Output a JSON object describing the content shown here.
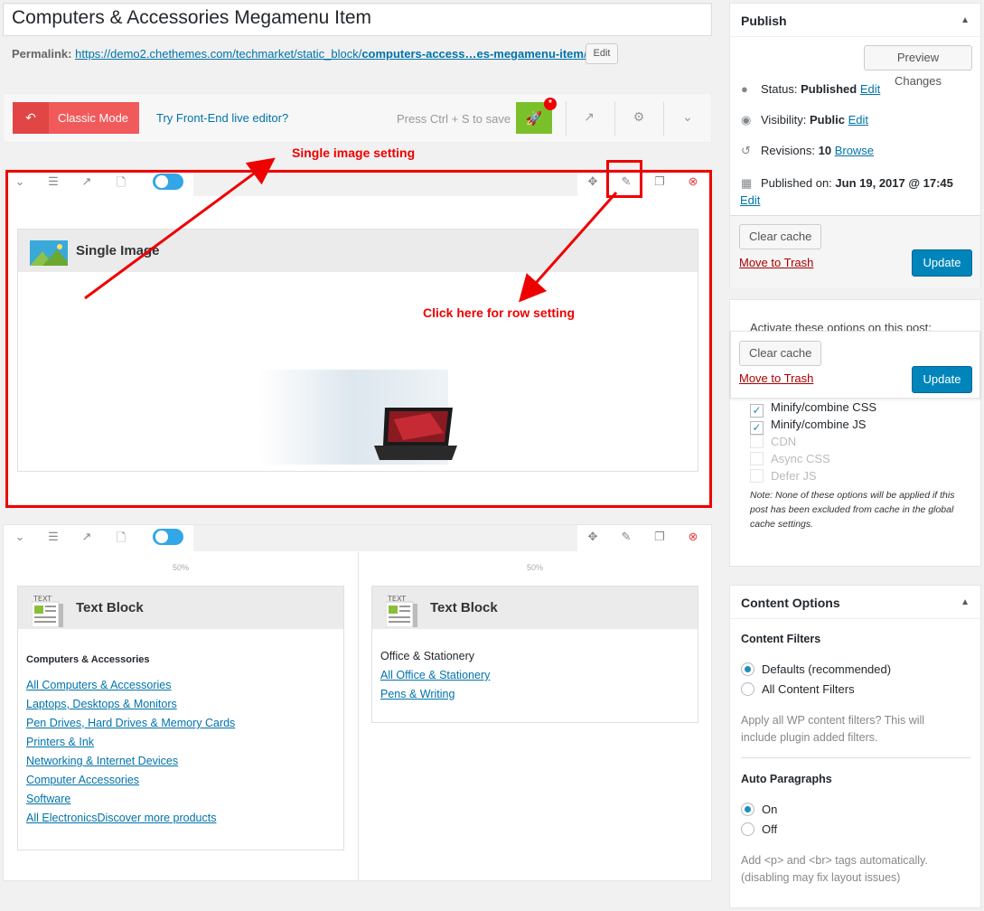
{
  "post": {
    "title": "Computers & Accessories Megamenu Item",
    "permalink_label": "Permalink:",
    "permalink_base": "https://demo2.chethemes.com/techmarket/static_block/",
    "permalink_slug": "computers-access…es-megamenu-item",
    "permalink_trailing": "/",
    "permalink_edit": "Edit"
  },
  "toolbar": {
    "classic_mode": "Classic Mode",
    "frontend_link": "Try Front-End live editor?",
    "save_hint": "Press Ctrl + S to save",
    "badge": "*"
  },
  "annotations": {
    "single_image_setting": "Single image setting",
    "row_setting": "Click here for row setting"
  },
  "row1": {
    "element_name": "Single Image"
  },
  "row2": {
    "col1_width": "50%",
    "col2_width": "50%",
    "col1": {
      "element_name": "Text Block",
      "heading": "Computers & Accessories",
      "links": [
        "All Computers & Accessories",
        "Laptops, Desktops & Monitors",
        "Pen Drives, Hard Drives & Memory Cards",
        "Printers & Ink",
        "Networking & Internet Devices",
        "Computer Accessories",
        "Software",
        "All ElectronicsDiscover more products"
      ]
    },
    "col2": {
      "element_name": "Text Block",
      "heading": "Office & Stationery",
      "links": [
        "All Office & Stationery",
        "Pens & Writing"
      ]
    }
  },
  "publish": {
    "title": "Publish",
    "preview": "Preview Changes",
    "status_label": "Status:",
    "status_value": "Published",
    "status_edit": "Edit",
    "visibility_label": "Visibility:",
    "visibility_value": "Public",
    "visibility_edit": "Edit",
    "revisions_label": "Revisions:",
    "revisions_value": "10",
    "revisions_browse": "Browse",
    "published_label": "Published on:",
    "published_value": "Jun 19, 2017 @ 17:45",
    "published_edit": "Edit",
    "clear_cache": "Clear cache",
    "trash": "Move to Trash",
    "update": "Update"
  },
  "optimize": {
    "intro": "Activate these options on this post:",
    "clear_cache": "Clear cache",
    "trash": "Move to Trash",
    "update": "Update",
    "options": [
      {
        "label": "Minify/combine CSS",
        "checked": true,
        "disabled": false
      },
      {
        "label": "Minify/combine JS",
        "checked": true,
        "disabled": false
      },
      {
        "label": "CDN",
        "checked": false,
        "disabled": true
      },
      {
        "label": "Async CSS",
        "checked": false,
        "disabled": true
      },
      {
        "label": "Defer JS",
        "checked": false,
        "disabled": true
      }
    ],
    "note": "Note: None of these options will be applied if this post has been excluded from cache in the global cache settings."
  },
  "content_options": {
    "title": "Content Options",
    "filters_heading": "Content Filters",
    "filter_default": "Defaults (recommended)",
    "filter_all": "All Content Filters",
    "filters_help": "Apply all WP content filters? This will include plugin added filters.",
    "paragraphs_heading": "Auto Paragraphs",
    "para_on": "On",
    "para_off": "Off",
    "paragraphs_help": "Add <p> and <br> tags automatically. (disabling may fix layout issues)"
  }
}
